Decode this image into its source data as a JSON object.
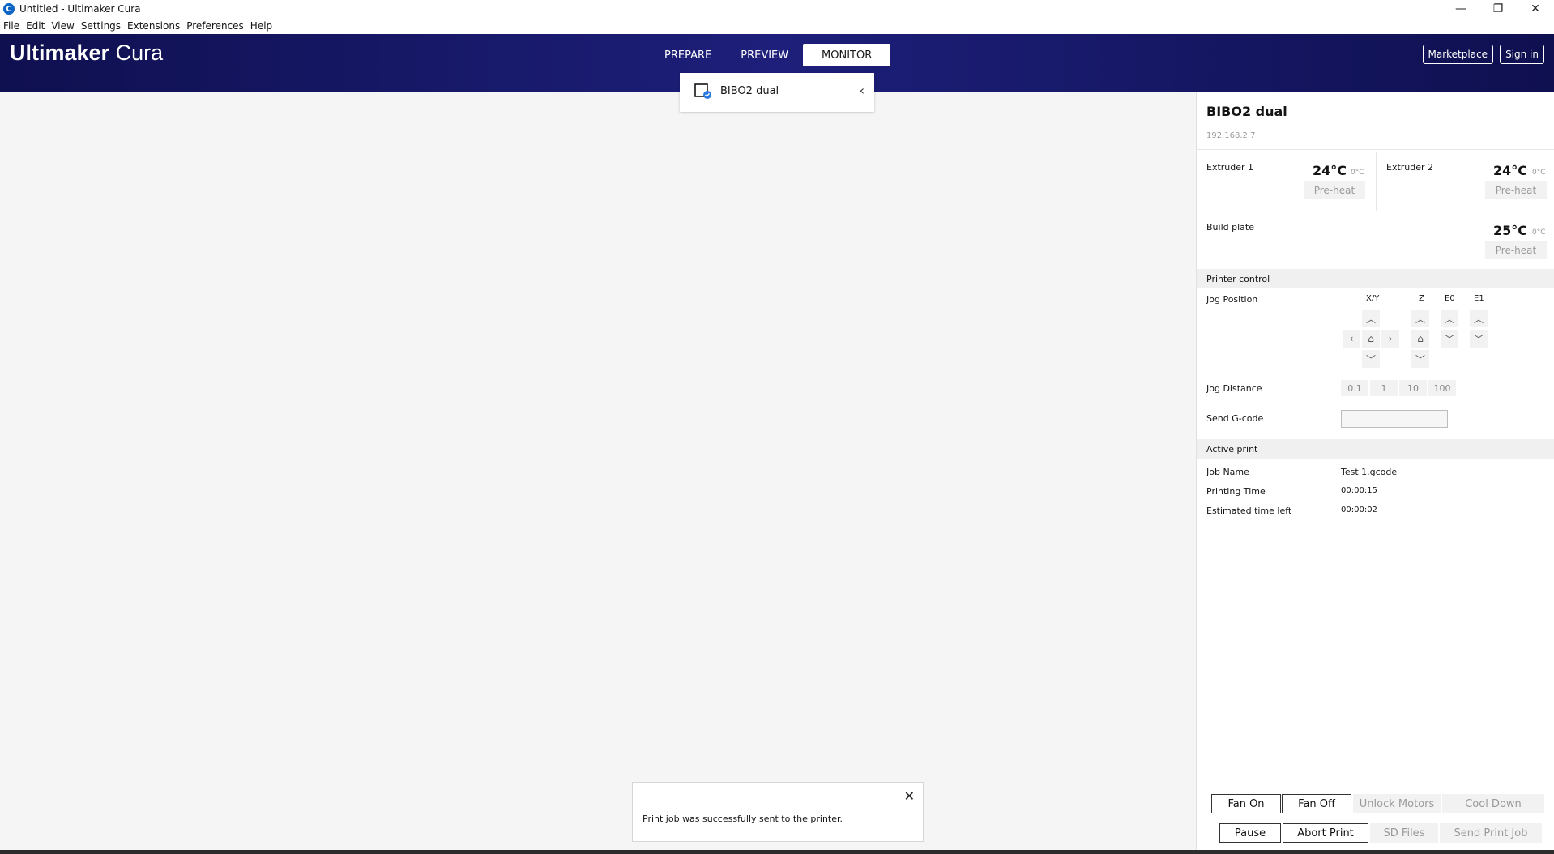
{
  "window": {
    "title": "Untitled - Ultimaker Cura"
  },
  "menu": [
    "File",
    "Edit",
    "View",
    "Settings",
    "Extensions",
    "Preferences",
    "Help"
  ],
  "header": {
    "logo_bold": "Ultimaker",
    "logo_light": "Cura",
    "tabs": [
      "PREPARE",
      "PREVIEW",
      "MONITOR"
    ],
    "active_tab": "MONITOR",
    "marketplace": "Marketplace",
    "signin": "Sign in"
  },
  "printer_selector": {
    "name": "BIBO2 dual"
  },
  "panel": {
    "printer_name": "BIBO2 dual",
    "ip": "192.168.2.7",
    "extruder1": {
      "label": "Extruder 1",
      "temp": "24°C",
      "target": "0°C",
      "preheat": "Pre-heat"
    },
    "extruder2": {
      "label": "Extruder 2",
      "temp": "24°C",
      "target": "0°C",
      "preheat": "Pre-heat"
    },
    "buildplate": {
      "label": "Build plate",
      "temp": "25°C",
      "target": "0°C",
      "preheat": "Pre-heat"
    },
    "control": {
      "section": "Printer control",
      "jog_position": "Jog Position",
      "axes": [
        "X/Y",
        "Z",
        "E0",
        "E1"
      ],
      "jog_distance": "Jog Distance",
      "distances": [
        "0.1",
        "1",
        "10",
        "100"
      ],
      "send_gcode": "Send G-code"
    },
    "active": {
      "section": "Active print",
      "job_name_label": "Job Name",
      "job_name": "Test 1.gcode",
      "printing_time_label": "Printing Time",
      "printing_time": "00:00:15",
      "time_left_label": "Estimated time left",
      "time_left": "00:00:02"
    },
    "buttons": {
      "fan_on": "Fan On",
      "fan_off": "Fan Off",
      "unlock": "Unlock Motors",
      "cool": "Cool Down",
      "pause": "Pause",
      "abort": "Abort Print",
      "sd": "SD Files",
      "send": "Send Print Job"
    }
  },
  "toast": {
    "message": "Print job was successfully sent to the printer."
  },
  "icons": {
    "close": "✕",
    "minimize": "—",
    "restore": "❐",
    "chev_left": "‹",
    "up": "︿",
    "down": "﹀",
    "left": "‹",
    "right": "›",
    "home": "⌂"
  }
}
